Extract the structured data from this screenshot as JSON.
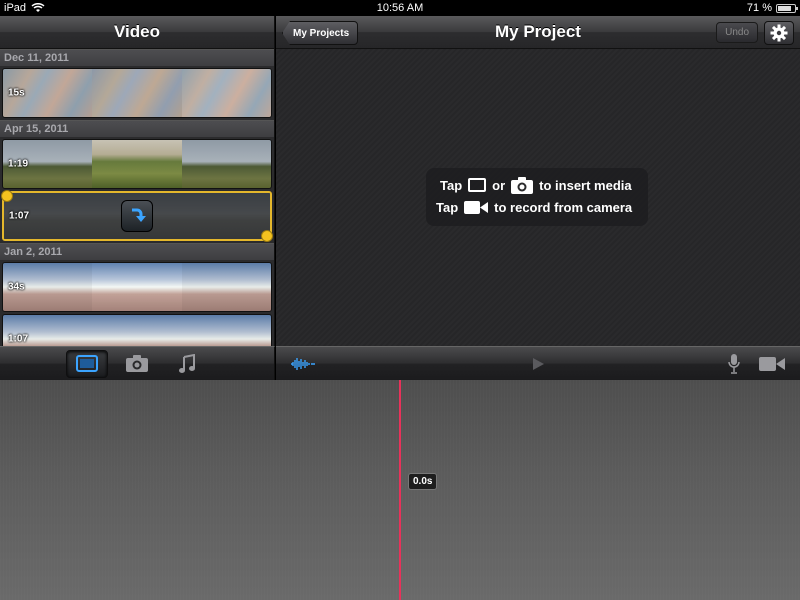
{
  "status_bar": {
    "device": "iPad",
    "time": "10:56 AM",
    "battery": "71 %",
    "battery_level": 0.71
  },
  "left_panel": {
    "title": "Video",
    "sections": [
      {
        "date": "Dec 11, 2011",
        "clips": [
          {
            "duration": "15s",
            "thumb": "map"
          }
        ]
      },
      {
        "date": "Apr 15, 2011",
        "clips": [
          {
            "duration": "1:19",
            "thumb": "field"
          },
          {
            "duration": "1:07",
            "thumb": "field",
            "selected": true
          }
        ]
      },
      {
        "date": "Jan 2, 2011",
        "clips": [
          {
            "duration": "34s",
            "thumb": "beach"
          },
          {
            "duration": "1:07",
            "thumb": "beach"
          }
        ]
      }
    ]
  },
  "right_panel": {
    "back_label": "My Projects",
    "title": "My Project",
    "undo_label": "Undo",
    "hint": {
      "line1_tap": "Tap",
      "line1_or": "or",
      "line1_rest": "to insert media",
      "line2_tap": "Tap",
      "line2_rest": "to record from camera"
    }
  },
  "toolbar": {
    "media_tabs": [
      "video-icon",
      "photo-icon",
      "music-icon"
    ],
    "active_tab": "video-icon",
    "right_icons": [
      "audio-waveform-icon",
      "play-icon",
      "microphone-icon",
      "camera-record-icon"
    ]
  },
  "timeline": {
    "playhead_time": "0.0s"
  },
  "colors": {
    "selection": "#e4b72c",
    "playhead": "#e8325a",
    "accent_blue": "#3ba4ff"
  }
}
